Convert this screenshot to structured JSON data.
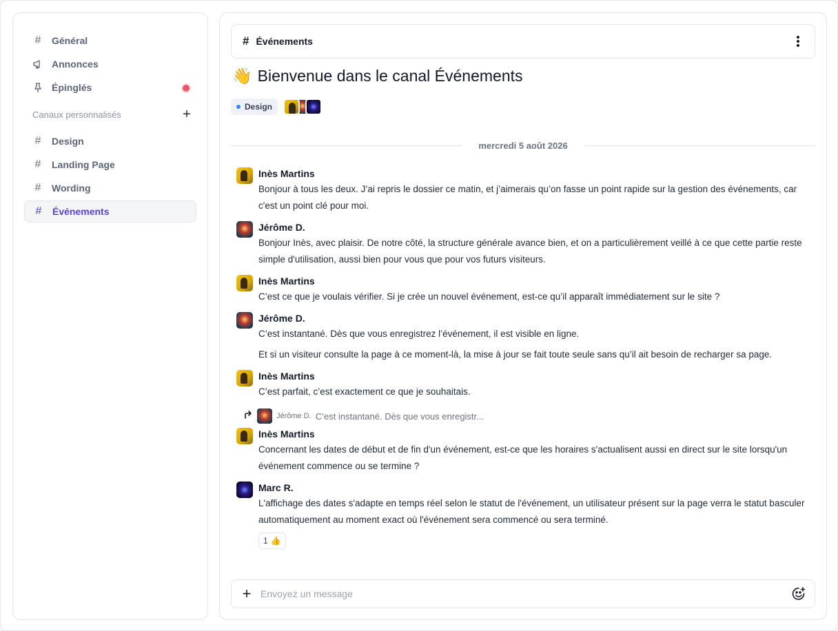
{
  "sidebar": {
    "items": [
      {
        "label": "Général",
        "icon": "hash-icon"
      },
      {
        "label": "Annonces",
        "icon": "megaphone-icon"
      },
      {
        "label": "Épinglés",
        "icon": "pin-icon",
        "has_notification": true
      }
    ],
    "section_label": "Canaux personnalisés",
    "channels": [
      {
        "label": "Design"
      },
      {
        "label": "Landing Page"
      },
      {
        "label": "Wording"
      },
      {
        "label": "Événements",
        "active": true
      }
    ]
  },
  "header": {
    "channel_name": "Événements"
  },
  "welcome": {
    "emoji": "👋",
    "title": "Bienvenue dans le canal Événements"
  },
  "tag": {
    "label": "Design"
  },
  "date_separator": "mercredi 5 août 2026",
  "messages": [
    {
      "author": "Inès Martins",
      "avatar": "ines",
      "lines": [
        "Bonjour à tous les deux. J’ai repris le dossier ce matin, et j’aimerais qu’on fasse un point rapide sur la gestion des événements, car c'est un point clé pour moi."
      ]
    },
    {
      "author": "Jérôme D.",
      "avatar": "jerome",
      "lines": [
        "Bonjour Inès, avec plaisir. De notre côté, la structure générale avance bien, et on a particulièrement veillé à ce que cette partie reste simple d'utilisation, aussi bien pour vous que pour vos futurs visiteurs."
      ]
    },
    {
      "author": "Inès Martins",
      "avatar": "ines",
      "lines": [
        "C’est ce que je voulais vérifier. Si je crée un nouvel événement, est-ce qu’il apparaît immédiatement sur le site ?"
      ]
    },
    {
      "author": "Jérôme D.",
      "avatar": "jerome",
      "lines": [
        "C’est instantané. Dès que vous enregistrez l’événement, il est visible en ligne.",
        "Et si un visiteur consulte la page à ce moment-là, la mise à jour se fait toute seule sans qu’il ait besoin de recharger sa page."
      ]
    },
    {
      "author": "Inès Martins",
      "avatar": "ines",
      "lines": [
        "C’est parfait, c’est exactement ce que je souhaitais."
      ]
    },
    {
      "author": "Inès Martins",
      "avatar": "ines",
      "reply_to": {
        "author": "Jérôme D.",
        "text": "C’est instantané. Dès que vous enregistr..."
      },
      "lines": [
        "Concernant les dates de début et de fin d'un événement, est-ce que les horaires s'actualisent aussi en direct sur le site lorsqu'un événement commence ou se termine ?"
      ]
    },
    {
      "author": "Marc R.",
      "avatar": "marc",
      "lines": [
        "L'affichage des dates s'adapte en temps réel selon le statut de l'événement, un utilisateur présent sur la page verra le statut basculer automatiquement au moment exact où l'événement sera commencé ou sera terminé."
      ],
      "reaction": {
        "count": "1",
        "emoji": "👍"
      }
    }
  ],
  "composer": {
    "placeholder": "Envoyez un message"
  },
  "colors": {
    "accent": "#5b3fd6",
    "notification": "#f05466",
    "tag_dot": "#3b82f6"
  }
}
